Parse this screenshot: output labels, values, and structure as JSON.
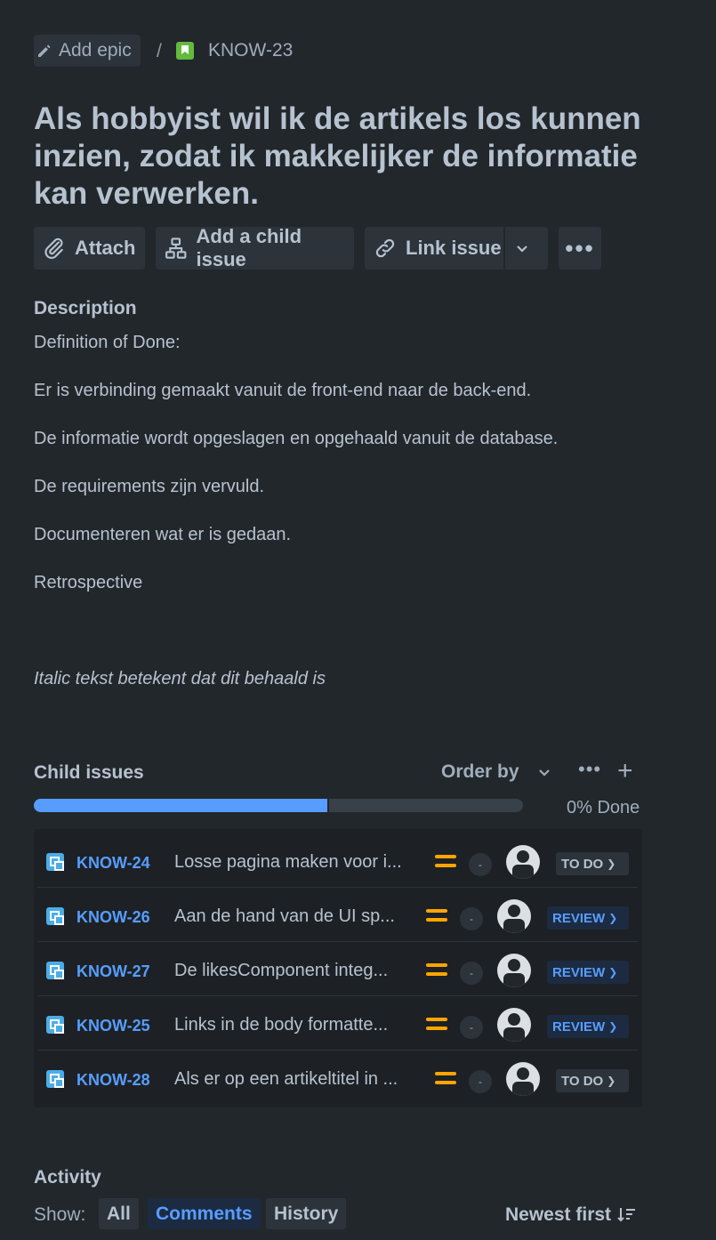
{
  "breadcrumb": {
    "epic_label": "Add epic",
    "separator": "/",
    "issue_key": "KNOW-23"
  },
  "title": "Als hobbyist wil ik de artikels los kunnen inzien, zodat ik makkelijker de informatie kan verwerken.",
  "actions": {
    "attach": "Attach",
    "add_child": "Add a child issue",
    "link_issue": "Link issue",
    "more": "•••"
  },
  "description": {
    "heading": "Description",
    "lines": [
      "Definition of Done:",
      "Er is verbinding gemaakt vanuit de front-end naar de back-end.",
      "De informatie wordt opgeslagen en opgehaald vanuit de database.",
      "De requirements zijn vervuld.",
      "Documenteren wat er is gedaan.",
      "Retrospective"
    ],
    "italic_note": "Italic tekst betekent dat dit behaald is"
  },
  "child_issues": {
    "heading": "Child issues",
    "order_by": "Order by",
    "more": "•••",
    "add": "+",
    "progress_label": "0% Done",
    "progress_fraction": 0.6,
    "items": [
      {
        "key": "KNOW-24",
        "summary": "Losse pagina maken voor i...",
        "estimate": "-",
        "status": "TO DO",
        "status_type": "todo"
      },
      {
        "key": "KNOW-26",
        "summary": "Aan de hand van de UI sp...",
        "estimate": "-",
        "status": "REVIEW",
        "status_type": "review"
      },
      {
        "key": "KNOW-27",
        "summary": "De likesComponent integ...",
        "estimate": "-",
        "status": "REVIEW",
        "status_type": "review"
      },
      {
        "key": "KNOW-25",
        "summary": "Links in de body formatte...",
        "estimate": "-",
        "status": "REVIEW",
        "status_type": "review"
      },
      {
        "key": "KNOW-28",
        "summary": "Als er op een artikeltitel in ...",
        "estimate": "-",
        "status": "TO DO",
        "status_type": "todo"
      }
    ]
  },
  "activity": {
    "heading": "Activity",
    "show_label": "Show:",
    "tabs": [
      "All",
      "Comments",
      "History"
    ],
    "active_tab": "Comments",
    "sort_label": "Newest first"
  },
  "colors": {
    "background": "#22272b",
    "accent_blue": "#579dff",
    "priority_medium": "#ffa500",
    "story_green": "#63ba3c",
    "subtask_blue": "#4bade8"
  },
  "icons": [
    "pencil-icon",
    "story-icon",
    "paperclip-icon",
    "hierarchy-icon",
    "link-icon",
    "chevron-down-icon",
    "more-icon",
    "plus-icon",
    "subtask-icon",
    "priority-medium-icon",
    "avatar-icon",
    "sort-icon"
  ]
}
